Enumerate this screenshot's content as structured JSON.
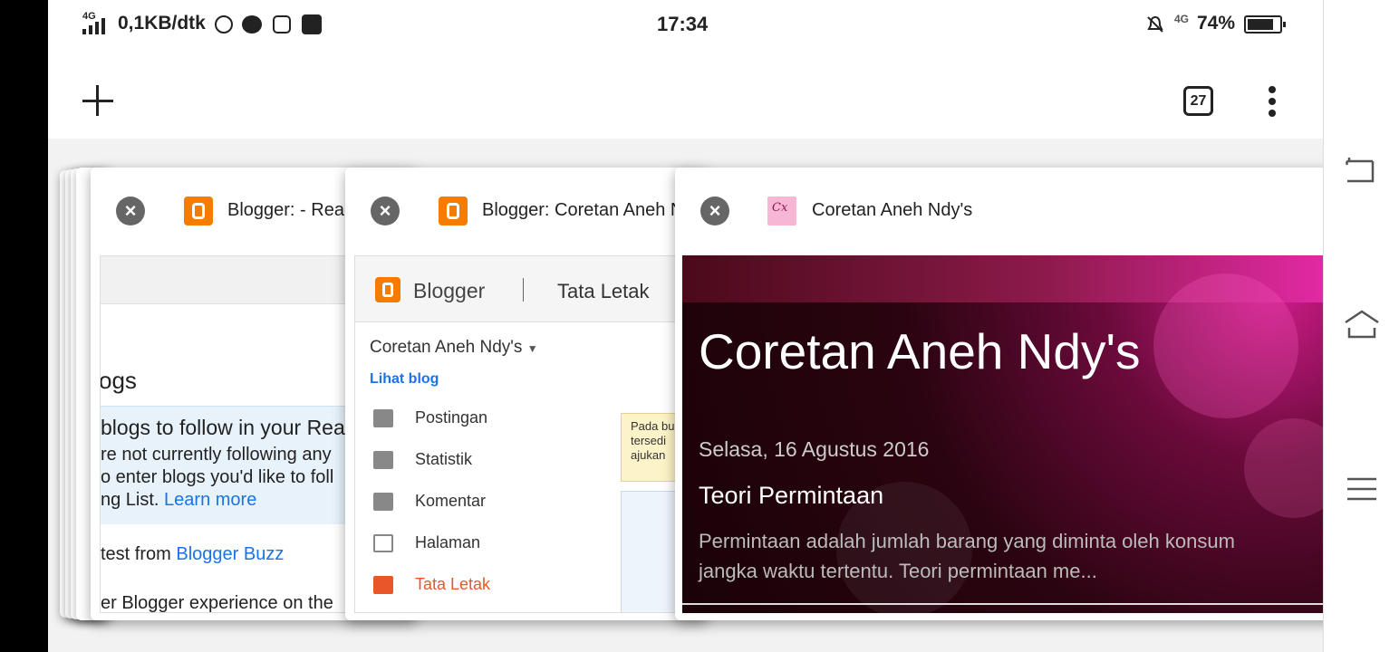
{
  "status_bar": {
    "signal": "4G",
    "speed": "0,1KB/dtk",
    "time": "17:34",
    "network": "4G",
    "battery": "74%"
  },
  "toolbar": {
    "tab_count": "27"
  },
  "tabs": [
    {
      "title": "Blogger: - Reac",
      "content": {
        "heading_partial": "ogs",
        "info_title": "blogs to follow in your Rea",
        "info_line1": "re not currently following any",
        "info_line2": "o enter blogs you'd like to foll",
        "info_line3": "ng List.",
        "learn_more": "Learn more",
        "latest_prefix": "test from",
        "latest_link": "Blogger Buzz",
        "bottom_line": "er Blogger experience on the"
      }
    },
    {
      "title": "Blogger: Coretan Aneh N",
      "content": {
        "brand": "Blogger",
        "section": "Tata Letak",
        "blog_name": "Coretan Aneh Ndy's",
        "view_blog": "Lihat blog",
        "menu": [
          "Postingan",
          "Statistik",
          "Komentar",
          "Halaman",
          "Tata Letak"
        ],
        "note_line1": "Pada bu",
        "note_line2": "tersedi",
        "note_line3": "ajukan"
      }
    },
    {
      "title": "Coretan Aneh Ndy's",
      "favicon_text": "Cx",
      "content": {
        "blog_title": "Coretan Aneh Ndy's",
        "date": "Selasa, 16 Agustus 2016",
        "post_title": "Teori Permintaan",
        "excerpt_line1": "Permintaan adalah jumlah barang yang diminta oleh konsum",
        "excerpt_line2": "jangka waktu tertentu. Teori permintaan me..."
      }
    }
  ],
  "colors": {
    "blogger_orange": "#f57c00",
    "link_blue": "#1a73e8",
    "active_menu": "#e8562a"
  }
}
